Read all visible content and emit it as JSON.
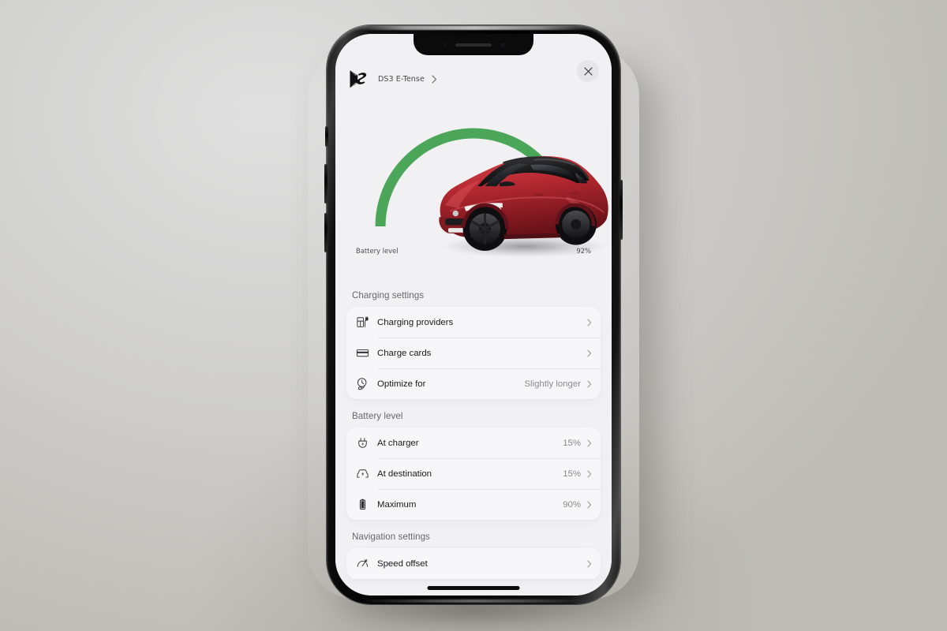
{
  "device": {
    "type": "smartphone",
    "notch": true,
    "home_indicator": true
  },
  "header": {
    "brand_logo": "ds-automobiles-logo",
    "vehicle_name": "DS3 E-Tense",
    "vehicle_chevron": "chevron-right-icon",
    "close_icon": "close-icon"
  },
  "gauge": {
    "label": "Battery level",
    "value_label": "92%",
    "percent": 92,
    "arc_color": "#4CA659",
    "track_color": "#f4f4f6",
    "car_image": "ds3-crossback-e-tense-red"
  },
  "sections": [
    {
      "title": "Charging settings",
      "rows": [
        {
          "icon": "charging-station-icon",
          "label": "Charging providers",
          "value": "",
          "chevron": "chevron-right-icon"
        },
        {
          "icon": "credit-card-icon",
          "label": "Charge cards",
          "value": "",
          "chevron": "chevron-right-icon"
        },
        {
          "icon": "clock-plug-icon",
          "label": "Optimize for",
          "value": "Slightly longer",
          "chevron": "chevron-right-icon"
        }
      ]
    },
    {
      "title": "Battery level",
      "rows": [
        {
          "icon": "plug-bolt-icon",
          "label": "At charger",
          "value": "15%",
          "chevron": "chevron-right-icon"
        },
        {
          "icon": "car-bolt-icon",
          "label": "At destination",
          "value": "15%",
          "chevron": "chevron-right-icon"
        },
        {
          "icon": "battery-icon",
          "label": "Maximum",
          "value": "90%",
          "chevron": "chevron-right-icon"
        }
      ]
    },
    {
      "title": "Navigation settings",
      "rows": [
        {
          "icon": "speedometer-icon",
          "label": "Speed offset",
          "value": "",
          "chevron": "chevron-right-icon"
        }
      ]
    }
  ],
  "colors": {
    "accent_green": "#4CA659",
    "screen_bg": "#f1f1f4",
    "card_bg": "#f7f7f9",
    "text_primary": "#18181b",
    "text_secondary": "#8a8a8f",
    "section_title": "#67676c"
  }
}
